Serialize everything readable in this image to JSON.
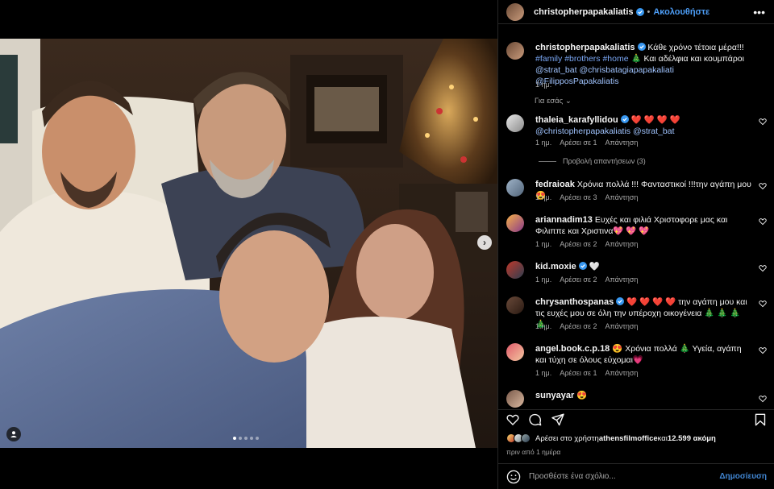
{
  "post": {
    "username": "christopherpapakaliatis",
    "follow_label": "Ακολουθήστε",
    "header_separator": "•",
    "more_label": "•••",
    "caption": {
      "text1": "Κάθε χρόνο τέτοια μέρα!!! ",
      "tag1": "#family",
      "tag2": "#brothers",
      "tag3": "#home",
      "text2": " 🎄 Και αδέλφια και κουμπάροι ",
      "mention1": "@strat_bat",
      "mention2": "@chrisbatagiapapakaliati",
      "mention3": "@FilipposPapakaliatis",
      "time": "1 ημ."
    },
    "for_you_label": "Για εσάς",
    "carousel": {
      "total": 5,
      "active": 1
    }
  },
  "comments": [
    {
      "username": "thaleia_karafyllidou",
      "verified": true,
      "text": " ❤️ ❤️ ❤️ ❤️ ",
      "mention1": "@christopherpapakaliatis",
      "mention2": "@strat_bat",
      "time": "1 ημ.",
      "likes": "Αρέσει σε 1",
      "reply": "Απάντηση",
      "view_replies": "Προβολή απαντήσεων (3)"
    },
    {
      "username": "fedraioak",
      "text": "Χρόνια πολλά !!! Φανταστικοί !!!την αγάπη μου 😍",
      "time": "1 ημ.",
      "likes": "Αρέσει σε 3",
      "reply": "Απάντηση"
    },
    {
      "username": "ariannadim13",
      "text": "Ευχές και φιλιά Χριστοφορε μας και Φιλιππε και Χριστινα💖 💖 💖",
      "time": "1 ημ.",
      "likes": "Αρέσει σε 2",
      "reply": "Απάντηση"
    },
    {
      "username": "kid.moxie",
      "verified": true,
      "text": "🤍",
      "time": "1 ημ.",
      "likes": "Αρέσει σε 2",
      "reply": "Απάντηση"
    },
    {
      "username": "chrysanthospanas",
      "verified": true,
      "text": "❤️ ❤️ ❤️ ❤️ την αγάπη μου και τις ευχές μου σε όλη την υπέροχη οικογένεια 🎄 🎄 🎄 🎄",
      "time": "1 ημ.",
      "likes": "Αρέσει σε 2",
      "reply": "Απάντηση"
    },
    {
      "username": "angel.book.c.p.18",
      "text": "😍 Χρόνια πολλά 🎄 Υγεία, αγάπη και τύχη σε όλους εύχομαι💗",
      "time": "1 ημ.",
      "likes": "Αρέσει σε 1",
      "reply": "Απάντηση"
    },
    {
      "username": "sunyayar",
      "text": "😍"
    }
  ],
  "likes_line": {
    "prefix": "Αρέσει στο χρήστη ",
    "user": "athensfilmoffice",
    "middle": " και ",
    "count": "12.599 ακόμη"
  },
  "date_label": "πριν από 1 ημέρα",
  "composer": {
    "placeholder": "Προσθέστε ένα σχόλιο...",
    "post_label": "Δημοσίευση"
  },
  "icons": {
    "like": "heart-icon",
    "comment": "comment-icon",
    "share": "share-icon",
    "save": "bookmark-icon",
    "emoji": "emoji-icon",
    "next": "chevron-right-icon",
    "tag": "user-tag-icon"
  },
  "colors": {
    "accent": "#4d9ef7",
    "link": "#a0c4ff",
    "verified": "#3897f0",
    "muted": "#a8a8a8"
  }
}
